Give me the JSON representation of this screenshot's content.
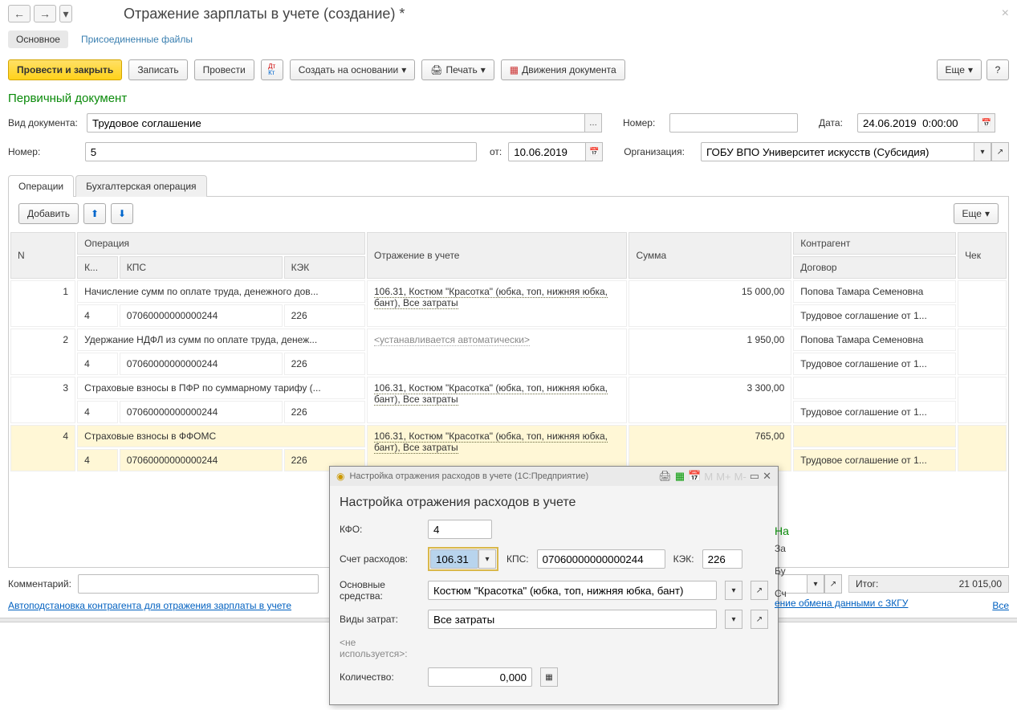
{
  "header": {
    "title": "Отражение зарплаты в учете (создание) *",
    "nav_main": "Основное",
    "nav_files": "Присоединенные файлы"
  },
  "toolbar": {
    "submit_close": "Провести и закрыть",
    "save": "Записать",
    "submit": "Провести",
    "create_based": "Создать на основании",
    "print": "Печать",
    "movements": "Движения документа",
    "more": "Еще",
    "help": "?"
  },
  "section": {
    "primary": "Первичный документ"
  },
  "form": {
    "doc_type_lbl": "Вид документа:",
    "doc_type": "Трудовое соглашение",
    "number_lbl": "Номер:",
    "number2_lbl": "Номер:",
    "number2": "5",
    "ot_lbl": "от:",
    "ot": "10.06.2019",
    "date_lbl": "Дата:",
    "date": "24.06.2019  0:00:00",
    "org_lbl": "Организация:",
    "org": "ГОБУ ВПО Университет искусств (Субсидия)"
  },
  "tabs": {
    "ops": "Операции",
    "acc": "Бухгалтерская операция"
  },
  "sub": {
    "add": "Добавить",
    "more": "Еще"
  },
  "cols": {
    "n": "N",
    "op": "Операция",
    "refl": "Отражение в учете",
    "sum": "Сумма",
    "contr": "Контрагент",
    "check": "Чек",
    "k": "К...",
    "kps": "КПС",
    "kek": "КЭК",
    "dog": "Договор"
  },
  "rows": [
    {
      "n": "1",
      "op": "Начисление сумм по оплате труда, денежного дов...",
      "k": "4",
      "kps": "07060000000000244",
      "kek": "226",
      "refl": "106.31, Костюм \"Красотка\" (юбка, топ, нижняя юбка, бант), Все затраты",
      "sum": "15 000,00",
      "contr": "Попова Тамара Семеновна",
      "dog": "Трудовое соглашение от 1..."
    },
    {
      "n": "2",
      "op": "Удержание НДФЛ из сумм по оплате труда, денеж...",
      "k": "4",
      "kps": "07060000000000244",
      "kek": "226",
      "refl": "<устанавливается автоматически>",
      "auto": true,
      "sum": "1 950,00",
      "contr": "Попова Тамара Семеновна",
      "dog": "Трудовое соглашение от 1..."
    },
    {
      "n": "3",
      "op": "Страховые взносы в ПФР по суммарному тарифу (...",
      "k": "4",
      "kps": "07060000000000244",
      "kek": "226",
      "refl": "106.31, Костюм \"Красотка\" (юбка, топ, нижняя юбка, бант), Все затраты",
      "sum": "3 300,00",
      "contr": "",
      "dog": "Трудовое соглашение от 1..."
    },
    {
      "n": "4",
      "op": "Страховые взносы в ФФОМС",
      "k": "4",
      "kps": "07060000000000244",
      "kek": "226",
      "refl": "106.31, Костюм \"Красотка\" (юбка, топ, нижняя юбка, бант), Все затраты",
      "sum": "765,00",
      "contr": "",
      "dog": "Трудовое соглашение от 1...",
      "hl": true
    }
  ],
  "bottom": {
    "comment_lbl": "Комментарий:",
    "auto_link": "Автоподстановка контрагента для отражения зарплаты в учете",
    "exchange_link": "ение обмена данными с ЗКГУ",
    "all": "Все",
    "total_lbl": "Итог:",
    "total": "21 015,00"
  },
  "ghost": {
    "h": "На",
    "l1": "За",
    "l2": "Бу",
    "l3": "Сч"
  },
  "dialog": {
    "titlebar": "Настройка отражения расходов в учете  (1С:Предприятие)",
    "title": "Настройка отражения расходов в учете",
    "kfo_lbl": "КФО:",
    "kfo": "4",
    "acc_lbl": "Счет расходов:",
    "acc": "106.31",
    "kps_lbl": "КПС:",
    "kps": "07060000000000244",
    "kek_lbl": "КЭК:",
    "kek": "226",
    "os_lbl": "Основные средства:",
    "os": "Костюм \"Красотка\" (юбка, топ, нижняя юбка, бант)",
    "vz_lbl": "Виды затрат:",
    "vz": "Все затраты",
    "nu_lbl": "<не используется>:",
    "qty_lbl": "Количество:",
    "qty": "0,000"
  }
}
